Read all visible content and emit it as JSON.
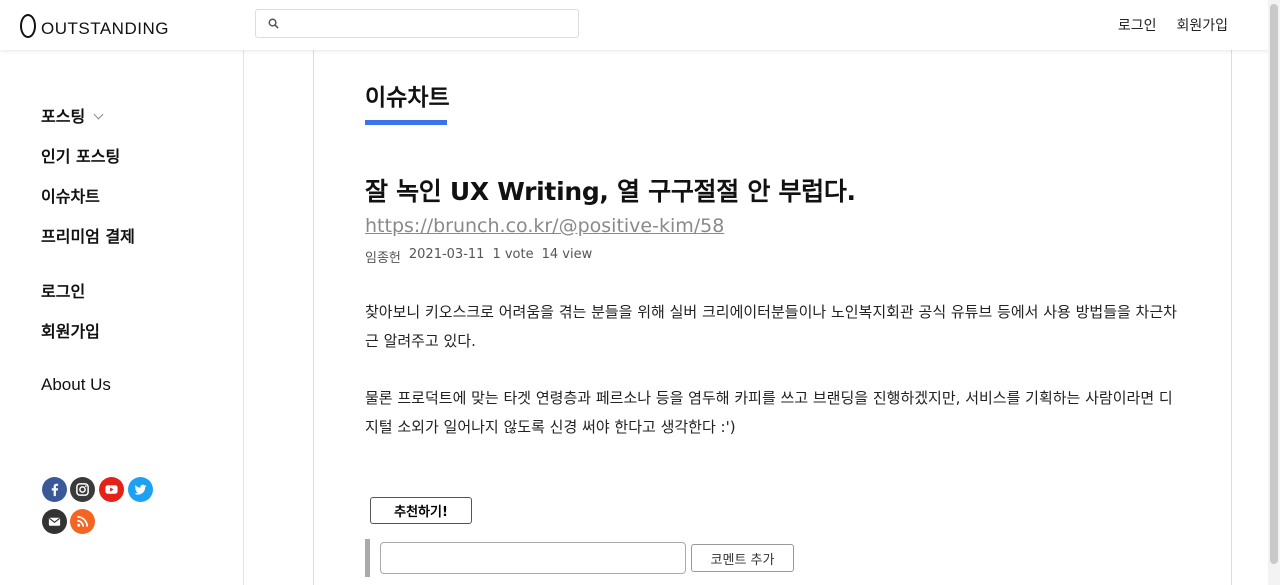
{
  "header": {
    "logo_text": "OUTSTANDING",
    "search_placeholder": "",
    "nav": {
      "login": "로그인",
      "signup": "회원가입"
    }
  },
  "sidebar": {
    "items": [
      {
        "label": "포스팅",
        "has_dropdown": true
      },
      {
        "label": "인기 포스팅"
      },
      {
        "label": "이슈차트"
      },
      {
        "label": "프리미엄 결제"
      },
      {
        "label": "로그인"
      },
      {
        "label": "회원가입"
      },
      {
        "label": "About Us"
      }
    ],
    "social": [
      {
        "icon": "facebook-icon",
        "color": "#3b5998"
      },
      {
        "icon": "instagram-icon",
        "color": "#3a3a3a"
      },
      {
        "icon": "youtube-icon",
        "color": "#e62117"
      },
      {
        "icon": "twitter-icon",
        "color": "#1da1f2"
      },
      {
        "icon": "mail-icon",
        "color": "#333333"
      },
      {
        "icon": "rss-icon",
        "color": "#f26522"
      }
    ]
  },
  "main": {
    "section_title": "이슈차트",
    "accent_color": "#3b73e8",
    "post": {
      "title": "잘 녹인 UX Writing, 열 구구절절 안 부럽다.",
      "link": "https://brunch.co.kr/@positive-kim/58",
      "author": "임종헌",
      "date": "2021-03-11",
      "votes": "1 vote",
      "views": "14 view",
      "paragraphs": [
        "찾아보니 키오스크로 어려움을 겪는 분들을 위해 실버 크리에이터분들이나 노인복지회관 공식 유튜브 등에서 사용 방법들을 차근차근 알려주고 있다.",
        "물론 프로덕트에 맞는 타겟 연령층과 페르소나 등을 염두해 카피를 쓰고 브랜딩을 진행하겠지만, 서비스를 기획하는 사람이라면 디지털 소외가 일어나지 않도록 신경 써야 한다고 생각한다 :')"
      ]
    },
    "recommend_label": "추천하기!",
    "comment": {
      "placeholder": "",
      "button_label": "코멘트 추가"
    }
  }
}
